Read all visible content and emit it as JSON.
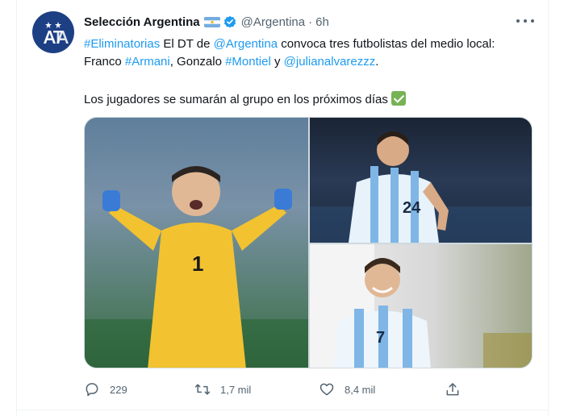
{
  "tweet": {
    "author": {
      "display_name": "Selección Argentina",
      "handle": "@Argentina",
      "avatar_icon": "afa-crest-icon",
      "avatar_color": "#1d3f84"
    },
    "time": "6h",
    "dot": "·",
    "text": {
      "l1_hashtag": "#Eliminatorias",
      "l1_a": " El DT de ",
      "l1_mention": "@Argentina",
      "l1_b": " convoca tres futbolistas del medio local:",
      "l2_a": "Franco ",
      "l2_hashtag1": "#Armani",
      "l2_b": ", Gonzalo ",
      "l2_hashtag2": "#Montiel",
      "l2_c": " y ",
      "l2_mention": "@julianalvarezzz",
      "l2_d": ".",
      "l3": "Los jugadores se sumarán al grupo en los próximos días"
    },
    "media": [
      {
        "icon": "goalkeeper-photo"
      },
      {
        "icon": "player-photo"
      },
      {
        "icon": "player-photo"
      }
    ],
    "actions": {
      "replies": "229",
      "retweets": "1,7 mil",
      "likes": "8,4 mil"
    }
  },
  "colors": {
    "link": "#1d9bf0",
    "text": "#0f1419",
    "secondary": "#536471",
    "verified": "#1d9bf0"
  }
}
